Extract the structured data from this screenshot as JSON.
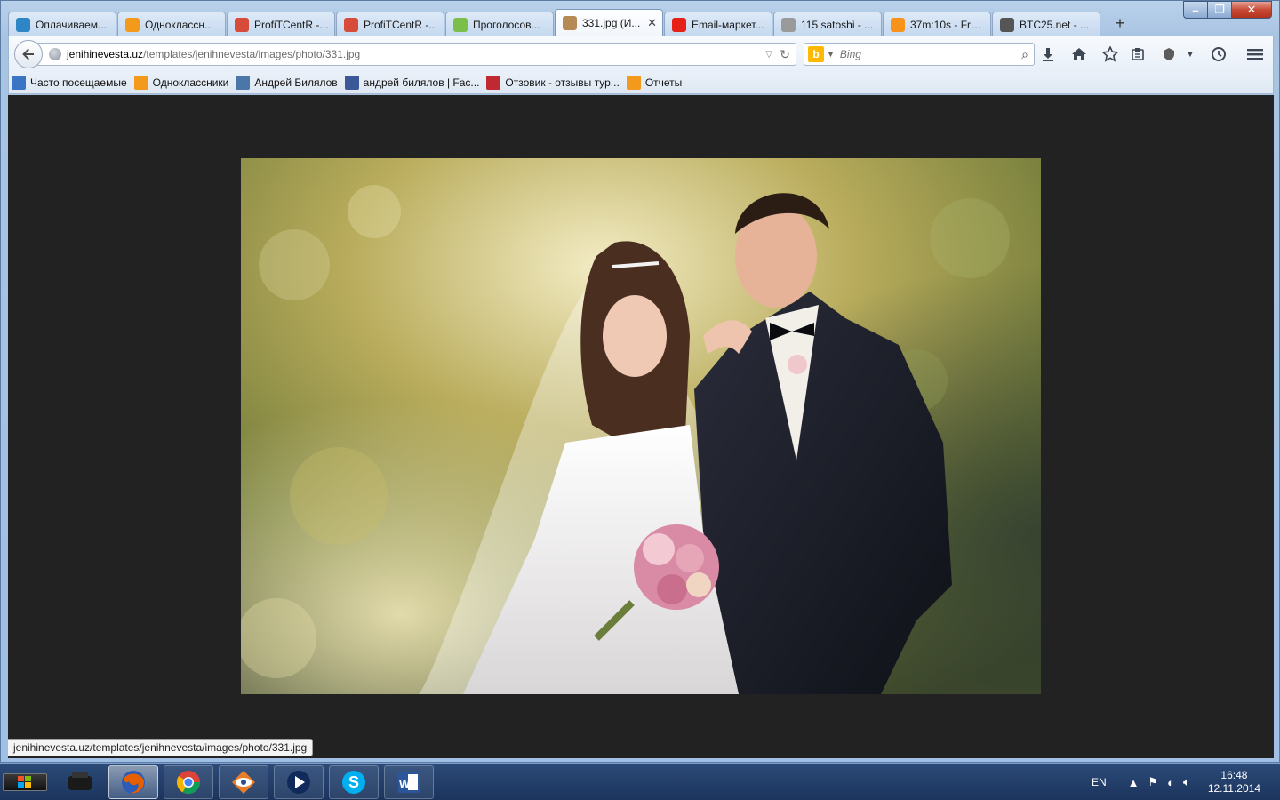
{
  "tabs": [
    {
      "title": "Оплачиваем...",
      "icon": "rating-icon",
      "color": "#2f86c7"
    },
    {
      "title": "Одноклассн...",
      "icon": "odnoklassniki-icon",
      "color": "#f39a1d"
    },
    {
      "title": "ProfiTCentR -...",
      "icon": "bar-chart-icon",
      "color": "#d64b3a"
    },
    {
      "title": "ProfiTCentR -...",
      "icon": "bar-chart-icon",
      "color": "#d64b3a"
    },
    {
      "title": "Проголосов...",
      "icon": "dots-icon",
      "color": "#7bbf4a"
    },
    {
      "title": "331.jpg (И...",
      "icon": "image-thumb-icon",
      "color": "#b58a55",
      "active": true
    },
    {
      "title": "Email-маркет...",
      "icon": "youtube-icon",
      "color": "#e62117"
    },
    {
      "title": "115 satoshi - ...",
      "icon": "coin-icon",
      "color": "#9a9a9a"
    },
    {
      "title": "37m:10s - Fre...",
      "icon": "bitcoin-icon",
      "color": "#f7931a"
    },
    {
      "title": "BTC25.net - ...",
      "icon": "btc-icon",
      "color": "#555555"
    }
  ],
  "new_tab_label": "+",
  "nav": {
    "url_domain": "jenihinevesta.uz",
    "url_path": "/templates/jenihnevesta/images/photo/331.jpg",
    "search_engine": "b",
    "search_placeholder": "Bing"
  },
  "bookmarks": [
    {
      "label": "Часто посещаемые",
      "icon": "folder-icon",
      "color": "#3b73c5"
    },
    {
      "label": "Одноклассники",
      "icon": "odnoklassniki-icon",
      "color": "#f39a1d"
    },
    {
      "label": "Андрей Билялов",
      "icon": "vk-icon",
      "color": "#4a76a8"
    },
    {
      "label": "андрей билялов | Fac...",
      "icon": "facebook-icon",
      "color": "#3b5998"
    },
    {
      "label": "Отзовик - отзывы тур...",
      "icon": "otzovik-icon",
      "color": "#c0292f"
    },
    {
      "label": "Отчеты",
      "icon": "reports-icon",
      "color": "#f39a1d"
    }
  ],
  "status_url": "jenihinevesta.uz/templates/jenihnevesta/images/photo/331.jpg",
  "taskbar": {
    "lang": "EN",
    "time": "16:48",
    "date": "12.11.2014"
  }
}
